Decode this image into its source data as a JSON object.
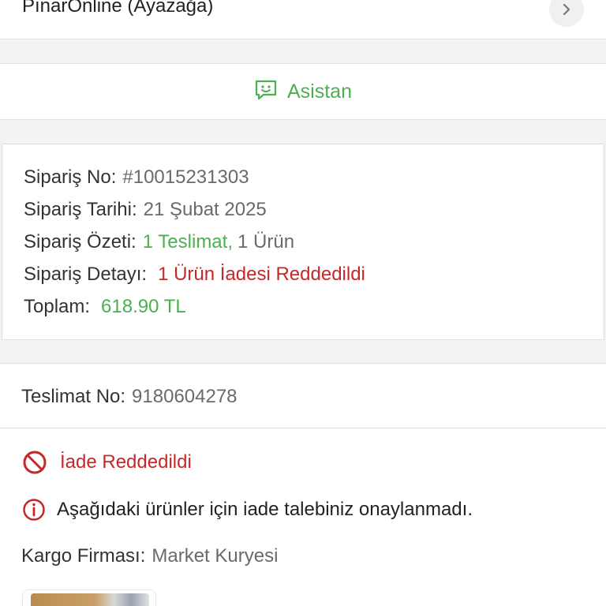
{
  "seller": {
    "name": "PınarOnline (Ayazağa)"
  },
  "assistant": {
    "label": "Asistan"
  },
  "order": {
    "number_label": "Sipariş No:",
    "number_value": "#10015231303",
    "date_label": "Sipariş Tarihi:",
    "date_value": "21 Şubat 2025",
    "summary_label": "Sipariş Özeti:",
    "summary_deliveries": "1 Teslimat,",
    "summary_items": "1 Ürün",
    "detail_label": "Sipariş Detayı:",
    "detail_value": "1 Ürün İadesi Reddedildi",
    "total_label": "Toplam:",
    "total_value": "618.90 TL"
  },
  "delivery": {
    "number_label": "Teslimat No:",
    "number_value": "9180604278",
    "status": "İade Reddedildi",
    "info": "Aşağıdaki ürünler için iade talebiniz onaylanmadı.",
    "carrier_label": "Kargo Firması:",
    "carrier_value": "Market Kuryesi"
  },
  "colors": {
    "green": "#4caf50",
    "red": "#c62828"
  },
  "icons": [
    "chevron-right-icon",
    "chat-assistant-icon",
    "prohibited-icon",
    "info-circle-icon"
  ]
}
